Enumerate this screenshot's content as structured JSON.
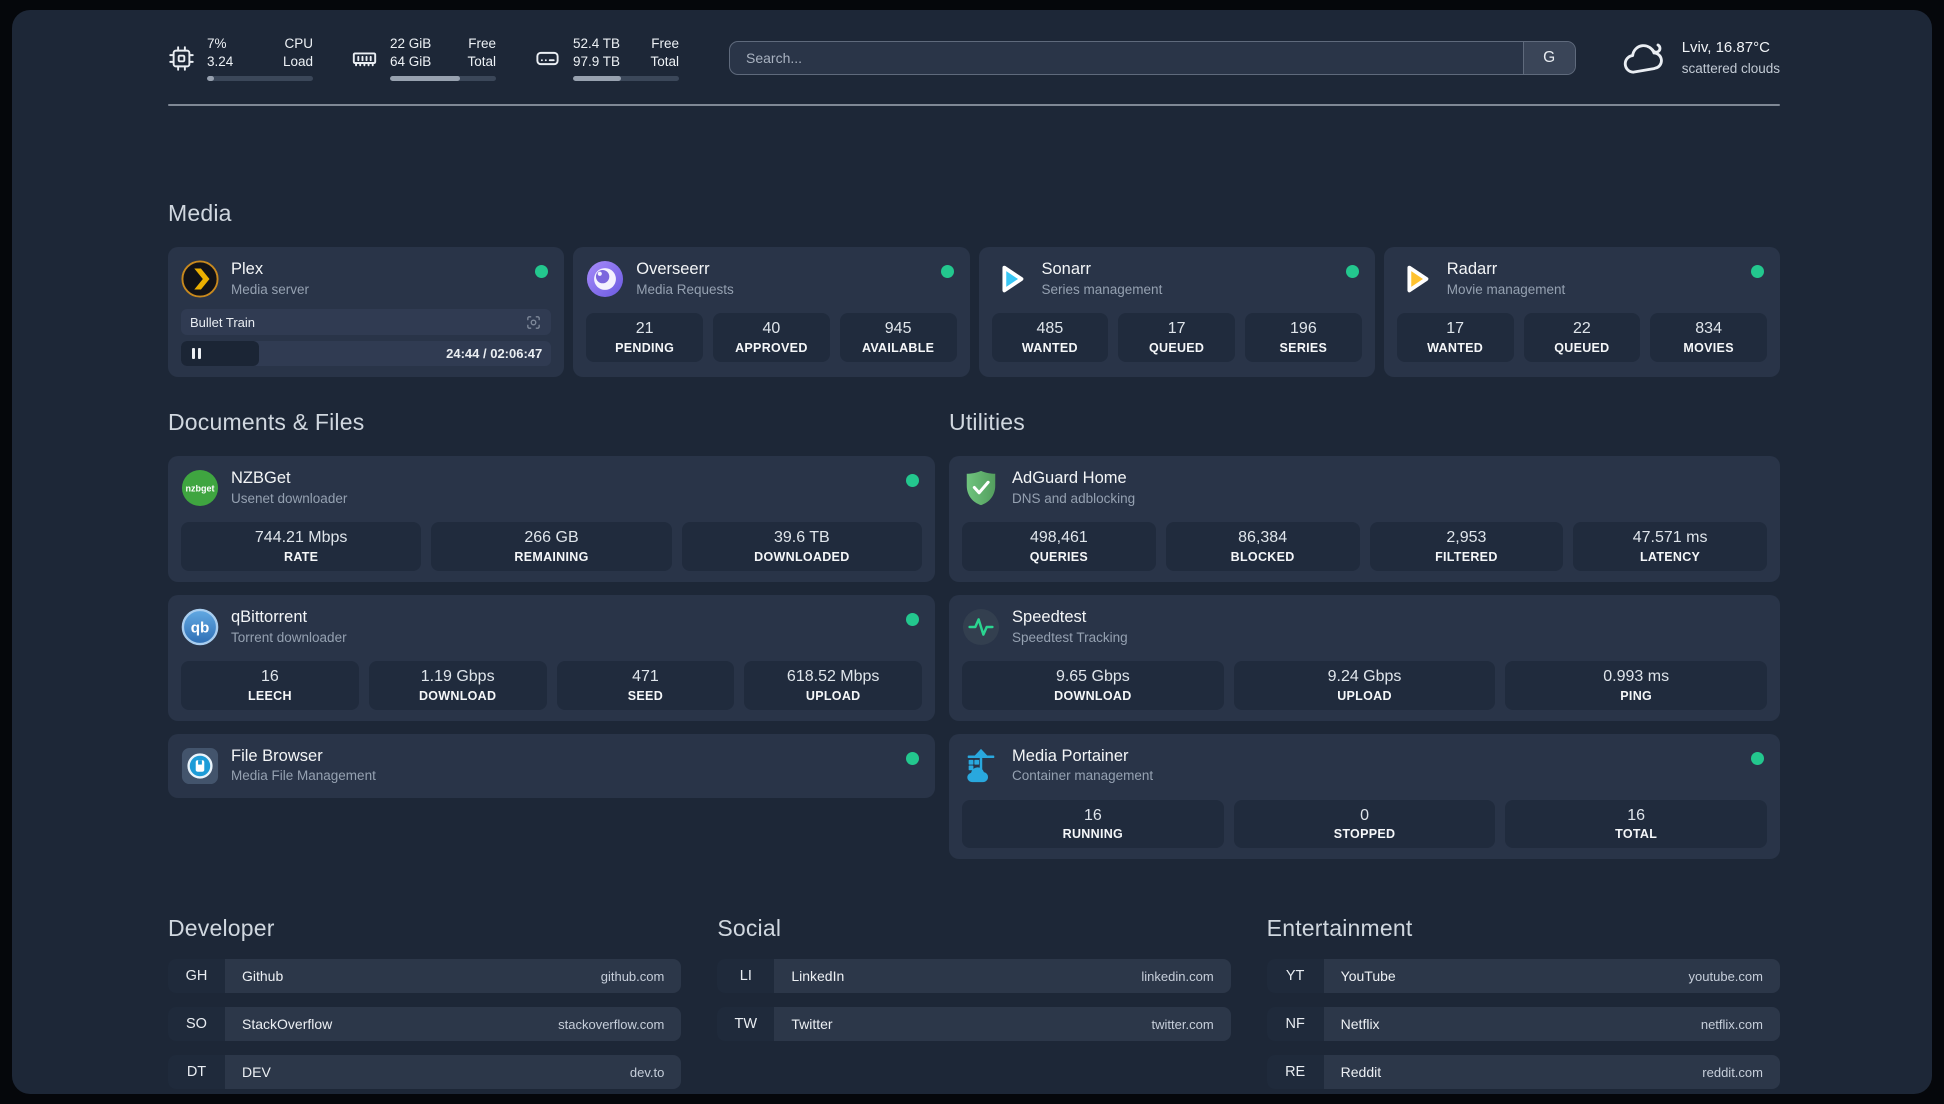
{
  "topbar": {
    "resources": [
      {
        "icon": "cpu-icon",
        "rows": [
          {
            "value": "7%",
            "label": "CPU"
          },
          {
            "value": "3.24",
            "label": "Load"
          }
        ],
        "progress_pct": 7
      },
      {
        "icon": "memory-icon",
        "rows": [
          {
            "value": "22 GiB",
            "label": "Free"
          },
          {
            "value": "64 GiB",
            "label": "Total"
          }
        ],
        "progress_pct": 66
      },
      {
        "icon": "disk-icon",
        "rows": [
          {
            "value": "52.4 TB",
            "label": "Free"
          },
          {
            "value": "97.9 TB",
            "label": "Total"
          }
        ],
        "progress_pct": 45
      }
    ],
    "search": {
      "placeholder": "Search...",
      "provider_button": "G"
    },
    "weather": {
      "location": "Lviv, 16.87°C",
      "condition": "scattered clouds"
    }
  },
  "sections": {
    "media": "Media",
    "documents": "Documents & Files",
    "utilities": "Utilities",
    "developer": "Developer",
    "social": "Social",
    "entertainment": "Entertainment"
  },
  "services": {
    "plex": {
      "name": "Plex",
      "desc": "Media server",
      "status": "online",
      "player": {
        "track": "Bullet Train",
        "time": "24:44 / 02:06:47",
        "progress_pct": 21
      }
    },
    "overseerr": {
      "name": "Overseerr",
      "desc": "Media Requests",
      "status": "online",
      "stats": [
        {
          "value": "21",
          "label": "PENDING"
        },
        {
          "value": "40",
          "label": "APPROVED"
        },
        {
          "value": "945",
          "label": "AVAILABLE"
        }
      ]
    },
    "sonarr": {
      "name": "Sonarr",
      "desc": "Series management",
      "status": "online",
      "stats": [
        {
          "value": "485",
          "label": "WANTED"
        },
        {
          "value": "17",
          "label": "QUEUED"
        },
        {
          "value": "196",
          "label": "SERIES"
        }
      ]
    },
    "radarr": {
      "name": "Radarr",
      "desc": "Movie management",
      "status": "online",
      "stats": [
        {
          "value": "17",
          "label": "WANTED"
        },
        {
          "value": "22",
          "label": "QUEUED"
        },
        {
          "value": "834",
          "label": "MOVIES"
        }
      ]
    },
    "nzbget": {
      "name": "NZBGet",
      "desc": "Usenet downloader",
      "status": "online",
      "stats": [
        {
          "value": "744.21 Mbps",
          "label": "RATE"
        },
        {
          "value": "266 GB",
          "label": "REMAINING"
        },
        {
          "value": "39.6 TB",
          "label": "DOWNLOADED"
        }
      ]
    },
    "qbittorrent": {
      "name": "qBittorrent",
      "desc": "Torrent downloader",
      "status": "online",
      "stats": [
        {
          "value": "16",
          "label": "LEECH"
        },
        {
          "value": "1.19 Gbps",
          "label": "DOWNLOAD"
        },
        {
          "value": "471",
          "label": "SEED"
        },
        {
          "value": "618.52 Mbps",
          "label": "UPLOAD"
        }
      ]
    },
    "filebrowser": {
      "name": "File Browser",
      "desc": "Media File Management",
      "status": "online"
    },
    "adguard": {
      "name": "AdGuard Home",
      "desc": "DNS and adblocking",
      "stats": [
        {
          "value": "498,461",
          "label": "QUERIES"
        },
        {
          "value": "86,384",
          "label": "BLOCKED"
        },
        {
          "value": "2,953",
          "label": "FILTERED"
        },
        {
          "value": "47.571 ms",
          "label": "LATENCY"
        }
      ]
    },
    "speedtest": {
      "name": "Speedtest",
      "desc": "Speedtest Tracking",
      "stats": [
        {
          "value": "9.65 Gbps",
          "label": "DOWNLOAD"
        },
        {
          "value": "9.24 Gbps",
          "label": "UPLOAD"
        },
        {
          "value": "0.993 ms",
          "label": "PING"
        }
      ]
    },
    "portainer": {
      "name": "Media Portainer",
      "desc": "Container management",
      "status": "online",
      "stats": [
        {
          "value": "16",
          "label": "RUNNING"
        },
        {
          "value": "0",
          "label": "STOPPED"
        },
        {
          "value": "16",
          "label": "TOTAL"
        }
      ]
    }
  },
  "bookmarks": {
    "developer": [
      {
        "abbr": "GH",
        "name": "Github",
        "url": "github.com"
      },
      {
        "abbr": "SO",
        "name": "StackOverflow",
        "url": "stackoverflow.com"
      },
      {
        "abbr": "DT",
        "name": "DEV",
        "url": "dev.to"
      }
    ],
    "social": [
      {
        "abbr": "LI",
        "name": "LinkedIn",
        "url": "linkedin.com"
      },
      {
        "abbr": "TW",
        "name": "Twitter",
        "url": "twitter.com"
      }
    ],
    "entertainment": [
      {
        "abbr": "YT",
        "name": "YouTube",
        "url": "youtube.com"
      },
      {
        "abbr": "NF",
        "name": "Netflix",
        "url": "netflix.com"
      },
      {
        "abbr": "RE",
        "name": "Reddit",
        "url": "reddit.com"
      }
    ]
  },
  "colors": {
    "background": "#1D2737",
    "card": "#293448",
    "stat_block": "#202B3D",
    "status_online": "#23C78E",
    "plex_brand": "#EBAF00",
    "sonarr_brand": "#38C6F4",
    "radarr_brand": "#FFC230",
    "speedtest_pulse": "#2BD490",
    "portainer_brand": "#29A8DE"
  }
}
